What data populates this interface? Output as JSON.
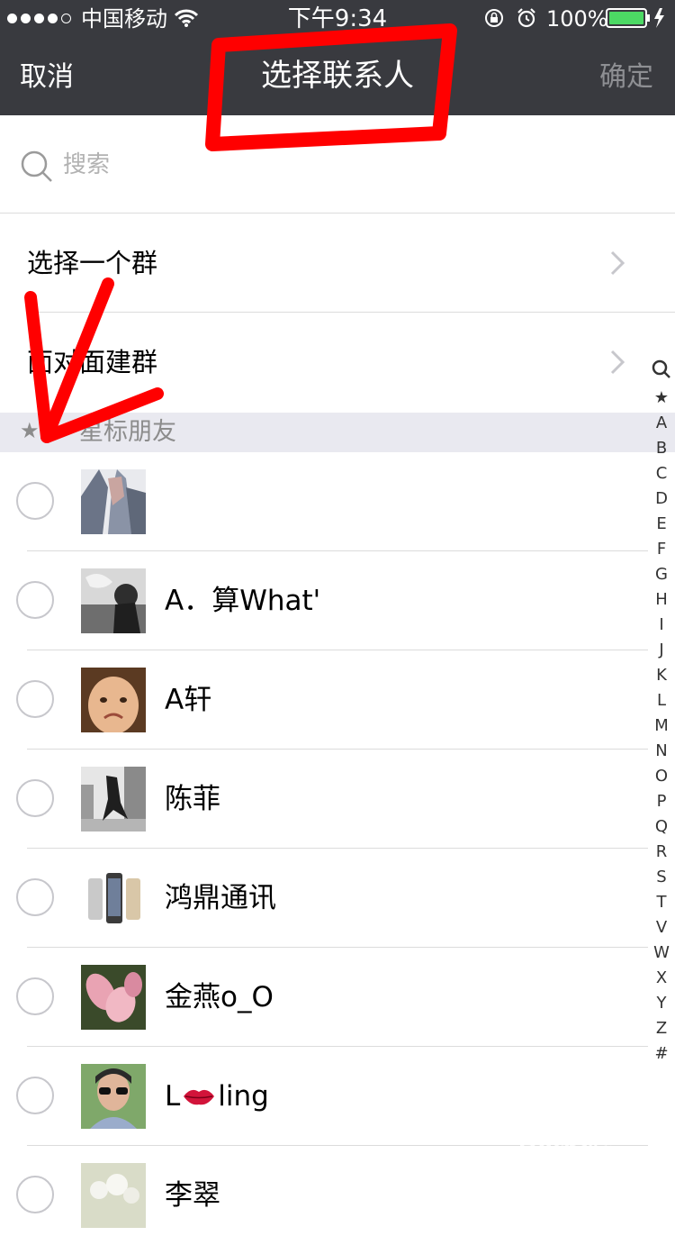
{
  "status_bar": {
    "carrier": "中国移动",
    "time": "下午9:34",
    "battery": "100%"
  },
  "nav": {
    "cancel": "取消",
    "title": "选择联系人",
    "confirm": "确定"
  },
  "search": {
    "placeholder": "搜索"
  },
  "menu": [
    {
      "label": "选择一个群"
    },
    {
      "label": "面对面建群"
    }
  ],
  "section": {
    "label": "星标朋友"
  },
  "contacts": [
    {
      "name": ""
    },
    {
      "name": "A．算What'"
    },
    {
      "name": "A轩"
    },
    {
      "name": "陈菲"
    },
    {
      "name": "鸿鼎通讯"
    },
    {
      "name": "金燕o_O"
    },
    {
      "name_prefix": "L",
      "name_suffix": "ling"
    },
    {
      "name": "李翠"
    }
  ],
  "index_letters": [
    "★",
    "A",
    "B",
    "C",
    "D",
    "E",
    "F",
    "G",
    "H",
    "I",
    "J",
    "K",
    "L",
    "M",
    "N",
    "O",
    "P",
    "Q",
    "R",
    "S",
    "T",
    "V",
    "W",
    "X",
    "Y",
    "Z",
    "#"
  ],
  "watermark": {
    "brand": "Bai经验",
    "url": "jingyan.baidu.com"
  },
  "colors": {
    "nav_bg": "#393a3f",
    "annotation": "#ff0000",
    "section_bg": "#e9e9f0"
  }
}
